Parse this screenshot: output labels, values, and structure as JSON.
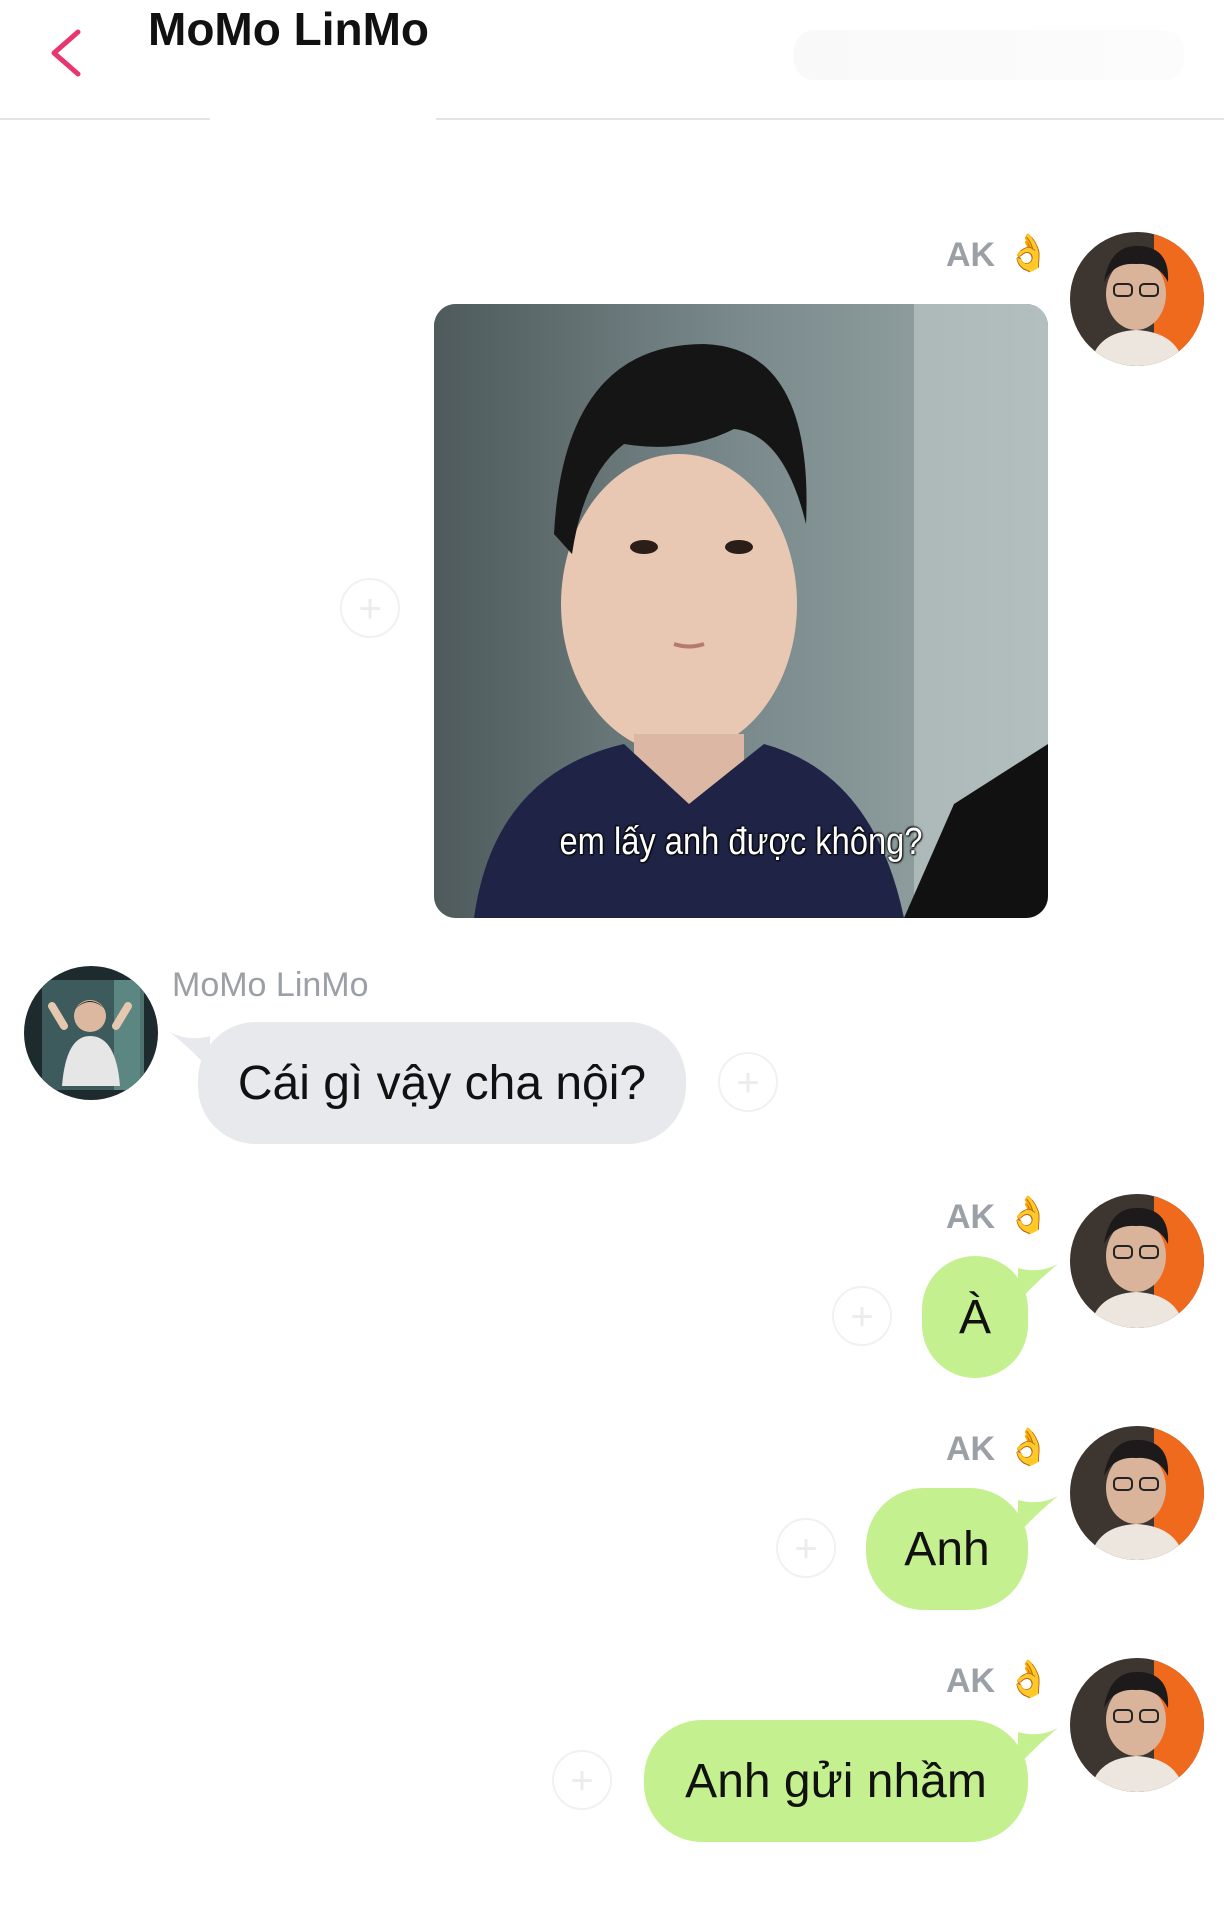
{
  "header": {
    "title": "MoMo LinMo",
    "back_icon": "chevron-left-icon"
  },
  "messages": [
    {
      "sender": "AK",
      "direction": "out",
      "type": "image",
      "caption": "em lấy anh được không?",
      "badge": "👌"
    },
    {
      "sender": "MoMo LinMo",
      "direction": "in",
      "type": "text",
      "text": "Cái gì vậy cha nội?"
    },
    {
      "sender": "AK",
      "direction": "out",
      "type": "text",
      "text": "À",
      "badge": "👌"
    },
    {
      "sender": "AK",
      "direction": "out",
      "type": "text",
      "text": "Anh",
      "badge": "👌"
    },
    {
      "sender": "AK",
      "direction": "out",
      "type": "text",
      "text": "Anh gửi nhầm",
      "badge": "👌"
    }
  ],
  "colors": {
    "accent_back": "#e8376f",
    "outgoing_bubble": "#c5f08f",
    "incoming_bubble": "#e8e9ec",
    "sender_name": "#9aa0a6"
  }
}
